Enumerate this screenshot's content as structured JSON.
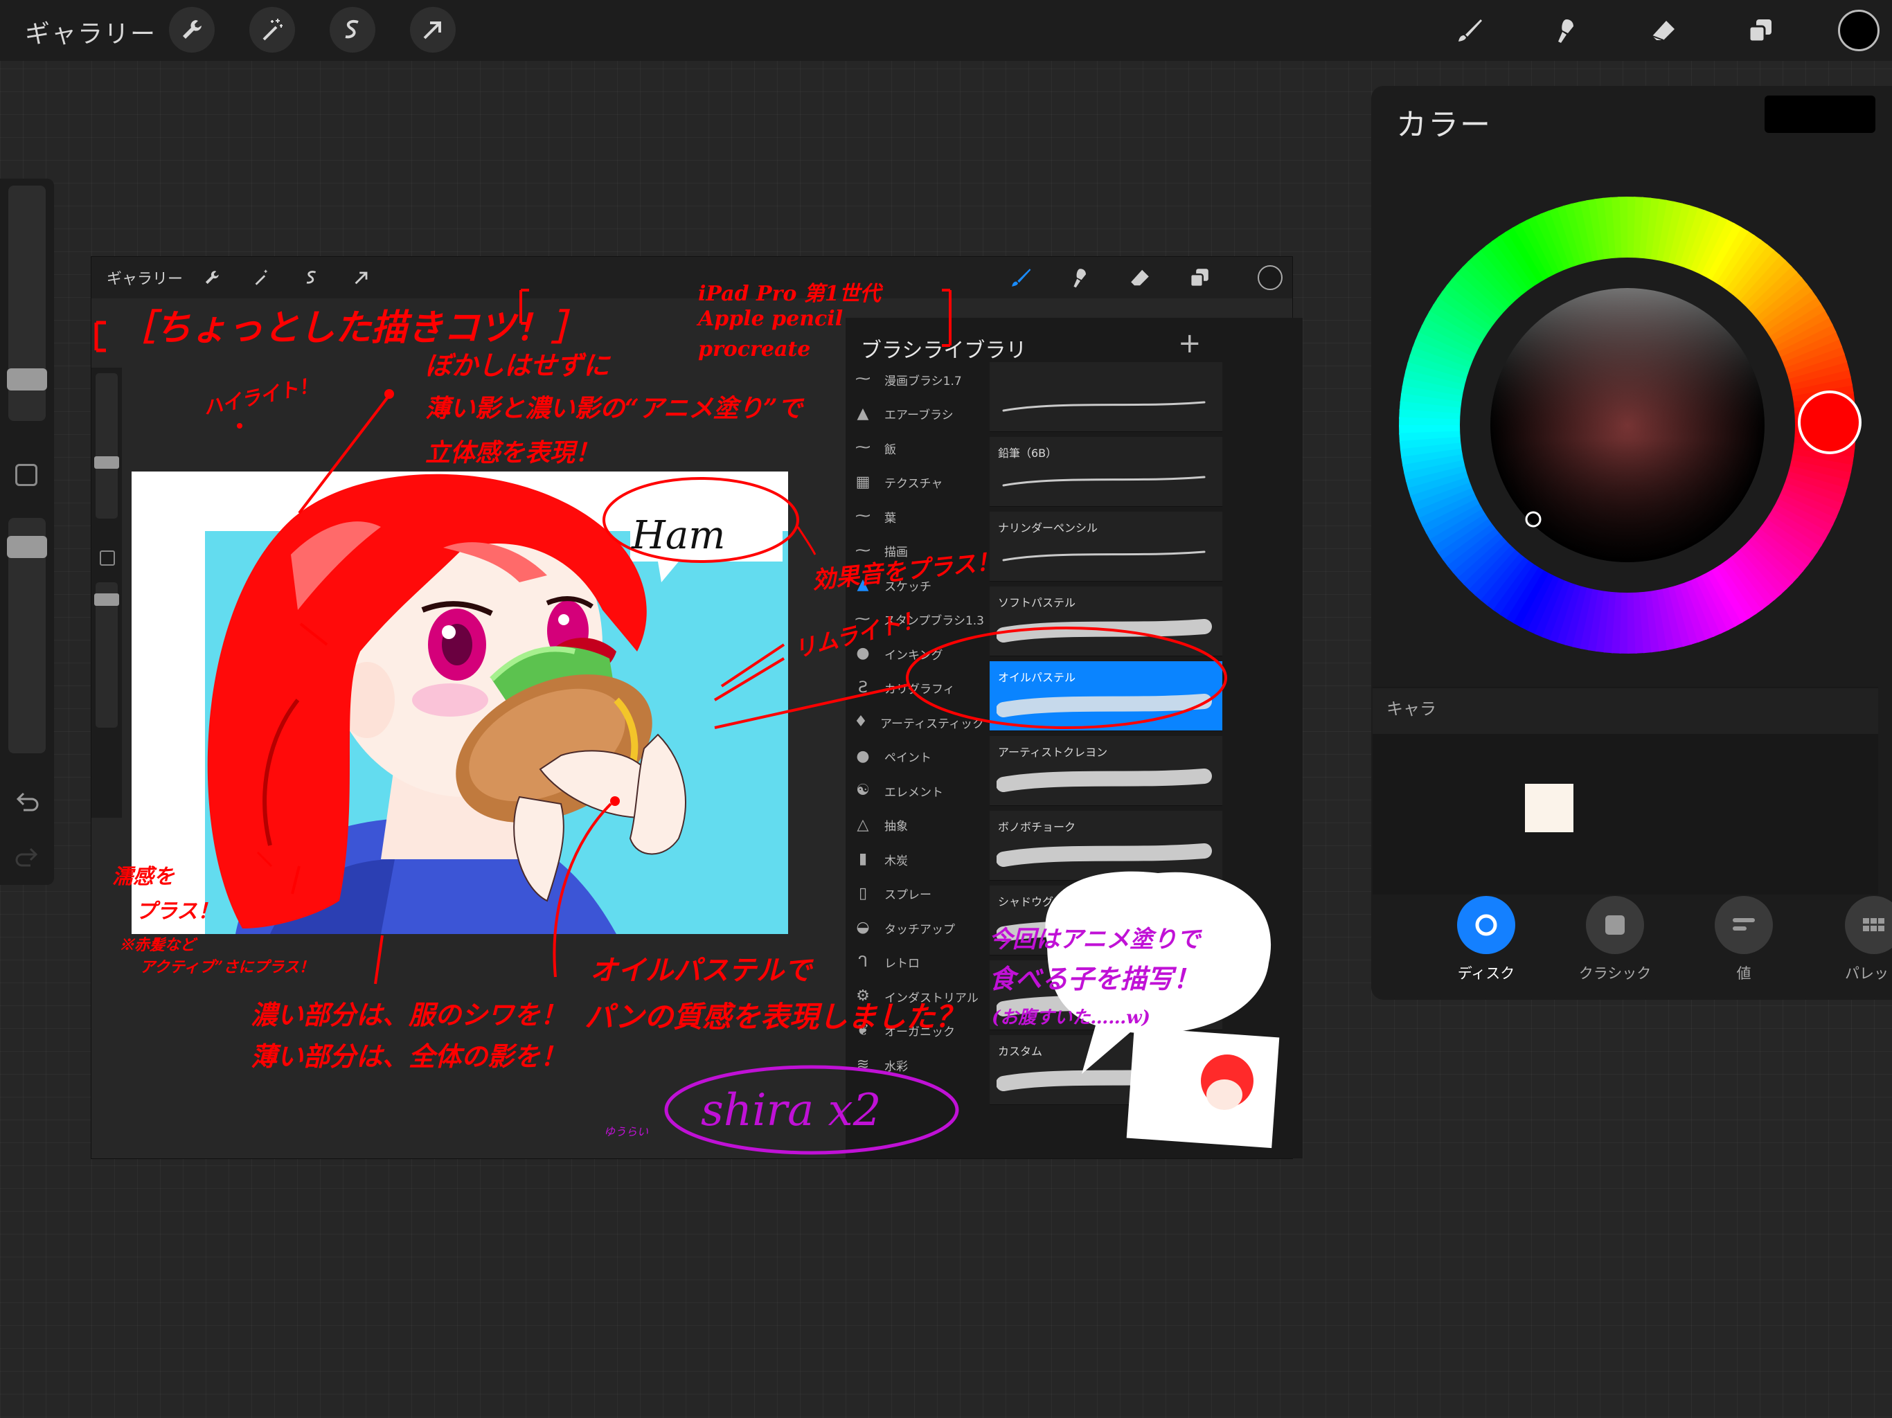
{
  "topbar": {
    "gallery_label": "ギャラリー",
    "tools_left": [
      "wrench-icon",
      "magic-wand-icon",
      "selection-icon",
      "transform-arrow-icon"
    ],
    "tools_right": [
      "brush-icon",
      "smudge-icon",
      "eraser-icon",
      "layers-icon"
    ],
    "current_color": "#000000"
  },
  "canvas": {
    "gallery_label": "ギャラリー",
    "annotations": {
      "heading": "［ちょっとした描きコツ！］",
      "note_blur": "ぼかしはせずに",
      "note_shadow": "薄い影と濃い影の“アニメ塗り”で",
      "note_volume": "立体感を表現！",
      "note_highlight": "ハイライト！",
      "device_1": "iPad Pro 第1世代",
      "device_2": "Apple pencil",
      "device_3": "procreate",
      "note_effect": "効果音をプラス！",
      "note_rim": "リムライト！",
      "note_wet_1": "濡感を",
      "note_wet_2": "プラス！",
      "note_wet_3": "※赤髪など",
      "note_wet_4": "アクティブ”さにプラス！",
      "note_dark_1": "濃い部分は、服のシワを！",
      "note_dark_2": "薄い部分は、全体の影を！",
      "note_oil_1": "オイルパステルで",
      "note_oil_2": "パンの質感を表現しました？",
      "bubble_1": "今回はアニメ塗りで",
      "bubble_2": "食べる子を描写！",
      "bubble_3": "(お腹すいた……w)",
      "signature_artwork": "Ham",
      "signature_author": "shira x2",
      "signature_prefix": "ゆうらい"
    },
    "brush_library": {
      "title": "ブラシライブラリ",
      "add_label": "+",
      "categories": [
        {
          "label": "漫画ブラシ1.7",
          "icon": "pen-stroke-icon"
        },
        {
          "label": "エアーブラシ",
          "icon": "airbrush-icon"
        },
        {
          "label": "飯",
          "icon": "pen-stroke-icon"
        },
        {
          "label": "テクスチャ",
          "icon": "texture-icon"
        },
        {
          "label": "葉",
          "icon": "pen-stroke-icon"
        },
        {
          "label": "描画",
          "icon": "pen-stroke-icon"
        },
        {
          "label": "スケッチ",
          "icon": "sketch-drop-icon"
        },
        {
          "label": "スタンプブラシ1.3",
          "icon": "pen-stroke-icon"
        },
        {
          "label": "インキング",
          "icon": "ink-drop-icon"
        },
        {
          "label": "カリグラフィ",
          "icon": "calligraphy-icon"
        },
        {
          "label": "アーティスティック",
          "icon": "artistic-drop-icon"
        },
        {
          "label": "ペイント",
          "icon": "paint-drop-icon"
        },
        {
          "label": "エレメント",
          "icon": "element-yin-yang-icon"
        },
        {
          "label": "抽象",
          "icon": "triangle-icon"
        },
        {
          "label": "木炭",
          "icon": "charcoal-icon"
        },
        {
          "label": "スプレー",
          "icon": "spray-can-icon"
        },
        {
          "label": "タッチアップ",
          "icon": "touchup-icon"
        },
        {
          "label": "レトロ",
          "icon": "retro-icon"
        },
        {
          "label": "インダストリアル",
          "icon": "industrial-icon"
        },
        {
          "label": "オーガニック",
          "icon": "leaf-icon"
        },
        {
          "label": "水彩",
          "icon": "water-waves-icon"
        }
      ],
      "brushes": [
        {
          "label": ""
        },
        {
          "label": "鉛筆（6B）"
        },
        {
          "label": "ナリンダーペンシル"
        },
        {
          "label": "ソフトパステル"
        },
        {
          "label": "オイルパステル"
        },
        {
          "label": "アーティストクレヨン"
        },
        {
          "label": "ボノボチョーク"
        },
        {
          "label": "シャドウグラファイト"
        },
        {
          "label": ""
        },
        {
          "label": "カスタム"
        }
      ],
      "selected_brush": "オイルパステル"
    }
  },
  "color_panel": {
    "title": "カラー",
    "current_color": "#000000",
    "hue_color": "#ff0000",
    "palette_name": "キャラ",
    "palette_chip": "#fbf3ea",
    "tabs": [
      {
        "label": "ディスク",
        "icon": "disc-icon",
        "active": true
      },
      {
        "label": "クラシック",
        "icon": "classic-square-icon",
        "active": false
      },
      {
        "label": "値",
        "icon": "value-sliders-icon",
        "active": false
      },
      {
        "label": "パレット",
        "icon": "palette-grid-icon",
        "active": false
      }
    ]
  }
}
